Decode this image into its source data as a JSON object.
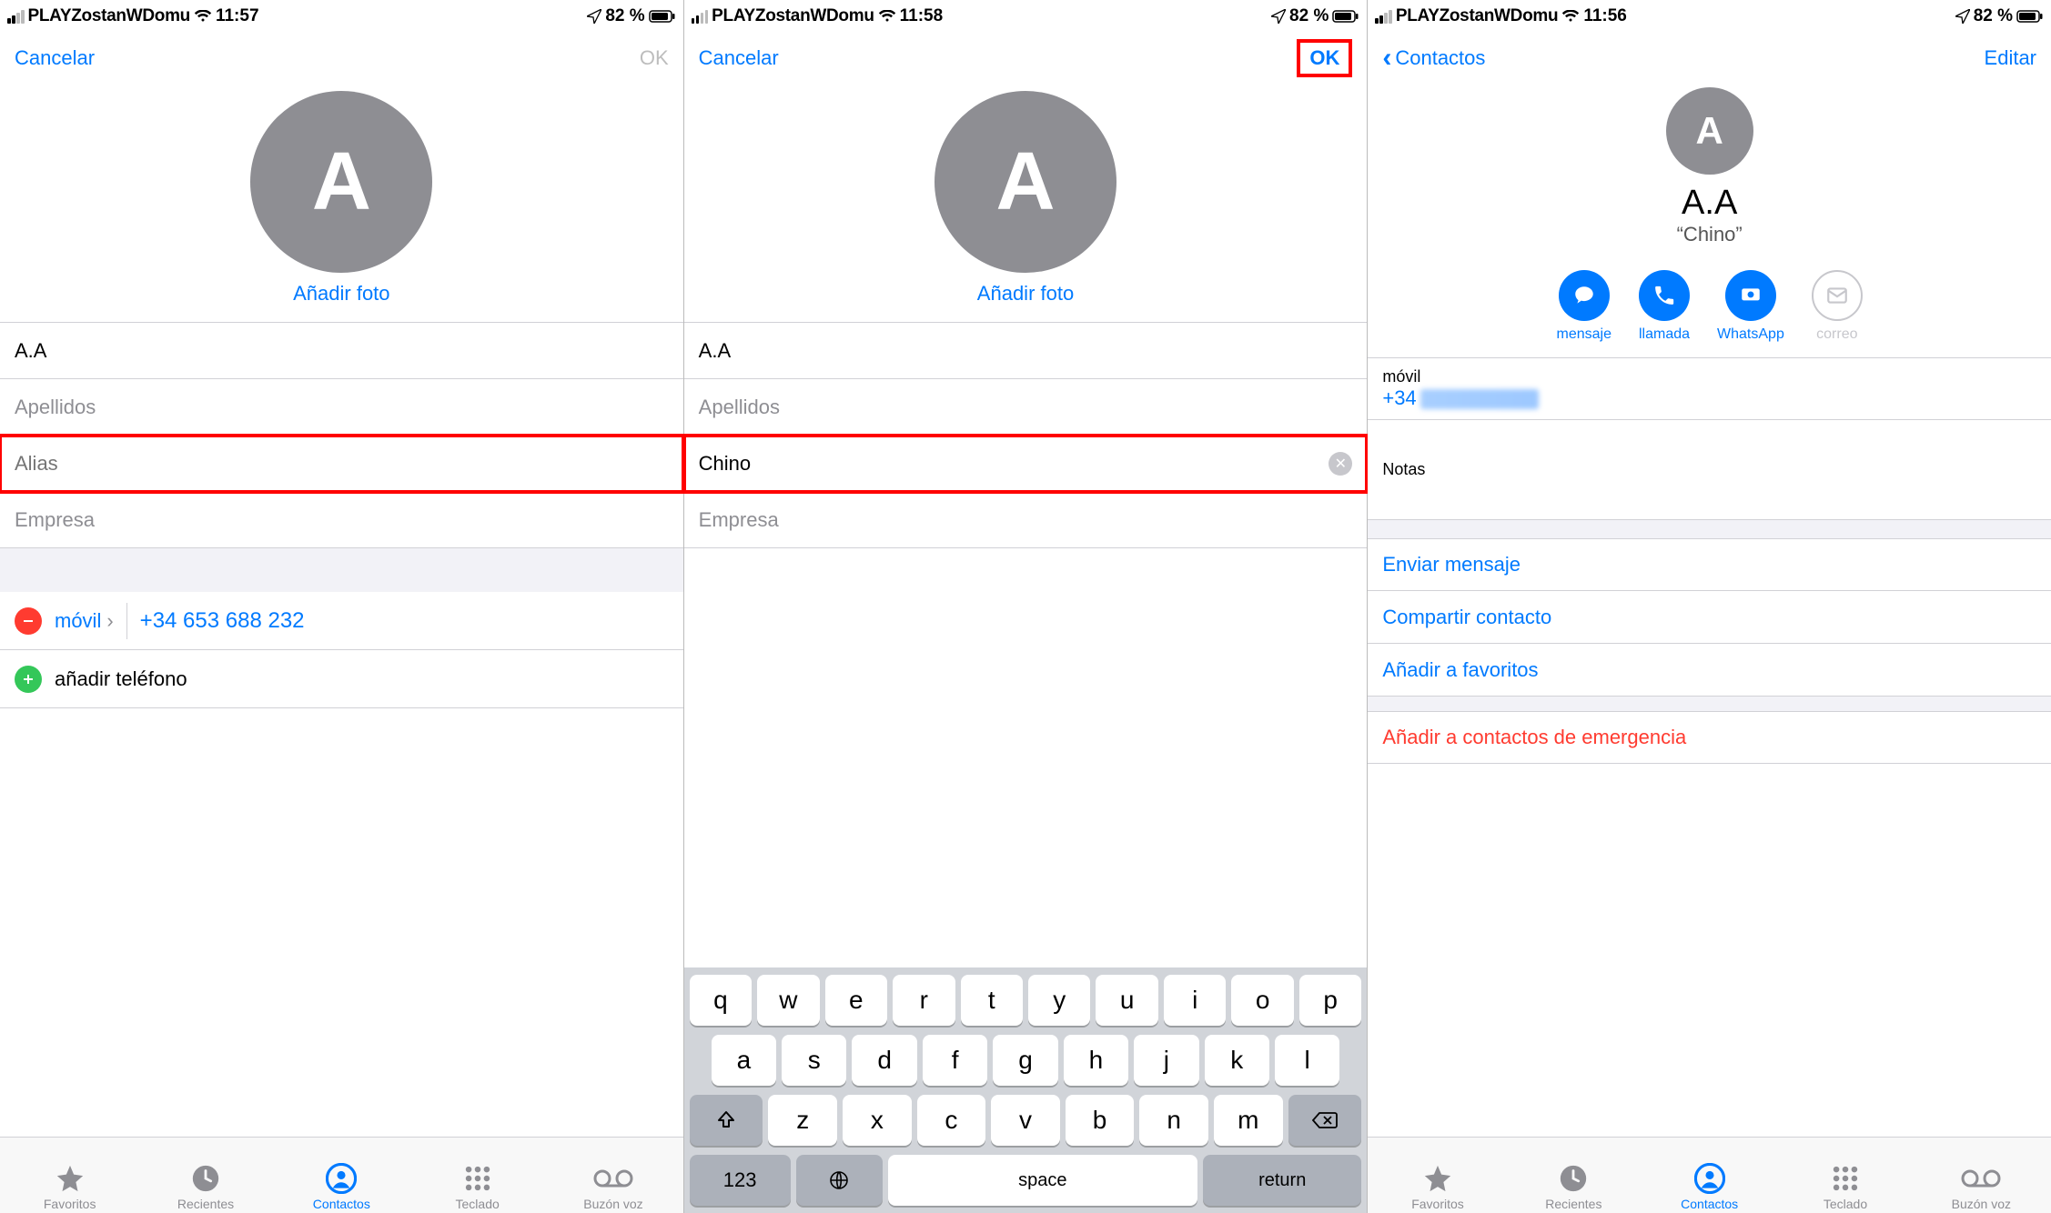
{
  "status": {
    "carrier": "PLAYZostanWDomu",
    "battery": "82 %",
    "times": {
      "s1": "11:57",
      "s2": "11:58",
      "s3": "11:56"
    }
  },
  "screen1": {
    "nav": {
      "cancel": "Cancelar",
      "ok": "OK"
    },
    "avatar_letter": "A",
    "add_photo": "Añadir foto",
    "fields": {
      "first_name_value": "A.A",
      "last_name_placeholder": "Apellidos",
      "alias_placeholder": "Alias",
      "alias_value": "",
      "company_placeholder": "Empresa"
    },
    "phone_type": "móvil",
    "phone_number": "+34 653 688 232",
    "add_phone": "añadir teléfono"
  },
  "screen2": {
    "nav": {
      "cancel": "Cancelar",
      "ok": "OK"
    },
    "avatar_letter": "A",
    "add_photo": "Añadir foto",
    "fields": {
      "first_name_value": "A.A",
      "last_name_placeholder": "Apellidos",
      "alias_value": "Chino",
      "company_placeholder": "Empresa"
    },
    "keyboard": {
      "row1": [
        "q",
        "w",
        "e",
        "r",
        "t",
        "y",
        "u",
        "i",
        "o",
        "p"
      ],
      "row2": [
        "a",
        "s",
        "d",
        "f",
        "g",
        "h",
        "j",
        "k",
        "l"
      ],
      "row3": [
        "z",
        "x",
        "c",
        "v",
        "b",
        "n",
        "m"
      ],
      "num": "123",
      "space": "space",
      "ret": "return"
    }
  },
  "screen3": {
    "nav": {
      "back": "Contactos",
      "edit": "Editar"
    },
    "avatar_letter": "A",
    "name": "A.A",
    "nickname": "“Chino”",
    "actions": [
      {
        "id": "message",
        "label": "mensaje",
        "enabled": true
      },
      {
        "id": "call",
        "label": "llamada",
        "enabled": true
      },
      {
        "id": "whatsapp",
        "label": "WhatsApp",
        "enabled": true
      },
      {
        "id": "mail",
        "label": "correo",
        "enabled": false
      }
    ],
    "phone_label": "móvil",
    "phone_prefix": "+34",
    "notes_label": "Notas",
    "links": {
      "send_message": "Enviar mensaje",
      "share_contact": "Compartir contacto",
      "add_fav": "Añadir a favoritos",
      "add_emergency": "Añadir a contactos de emergencia"
    }
  },
  "tabs": [
    {
      "id": "favs",
      "label": "Favoritos"
    },
    {
      "id": "recents",
      "label": "Recientes"
    },
    {
      "id": "contacts",
      "label": "Contactos",
      "active": true
    },
    {
      "id": "keypad",
      "label": "Teclado"
    },
    {
      "id": "voicemail",
      "label": "Buzón voz"
    }
  ]
}
